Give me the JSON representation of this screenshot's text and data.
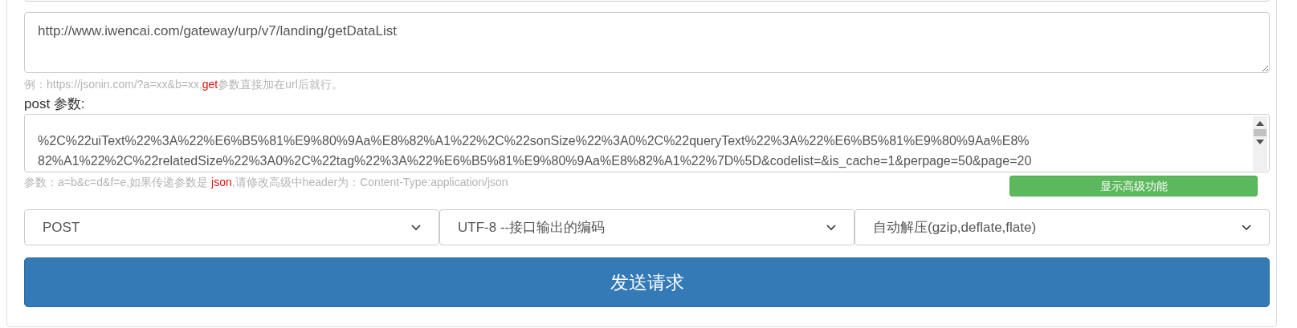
{
  "url_field": {
    "value": "http://www.iwencai.com/gateway/urp/v7/landing/getDataList"
  },
  "url_hint": {
    "prefix": "例：https://jsonin.com/?a=xx&b=xx,",
    "highlight": "get",
    "suffix": "参数直接加在url后就行。"
  },
  "params_label": "post 参数:",
  "params_field": {
    "lines": [
      "%2C%22uiText%22%3A%22%E6%B5%81%E9%80%9Aa%E8%82%A1%22%2C%22sonSize%22%3A0%2C%22queryText%22%3A%22%E6%B5%81%E9%80%9Aa%E8%",
      "82%A1%22%2C%22relatedSize%22%3A0%2C%22tag%22%3A%22%E6%B5%81%E9%80%9Aa%E8%82%A1%22%7D%5D&codelist=&is_cache=1&perpage=50&page=20"
    ]
  },
  "params_hint": {
    "prefix": "参数：a=b&c=d&f=e,如果传递参数是 ",
    "highlight": "json",
    "suffix": ",请修改高级中header为：Content-Type:application/json"
  },
  "advanced_button": "显示高级功能",
  "selects": [
    {
      "value": "POST"
    },
    {
      "value": "UTF-8 --接口输出的编码"
    },
    {
      "value": "自动解压(gzip,deflate,flate)"
    }
  ],
  "send_button": "发送请求"
}
